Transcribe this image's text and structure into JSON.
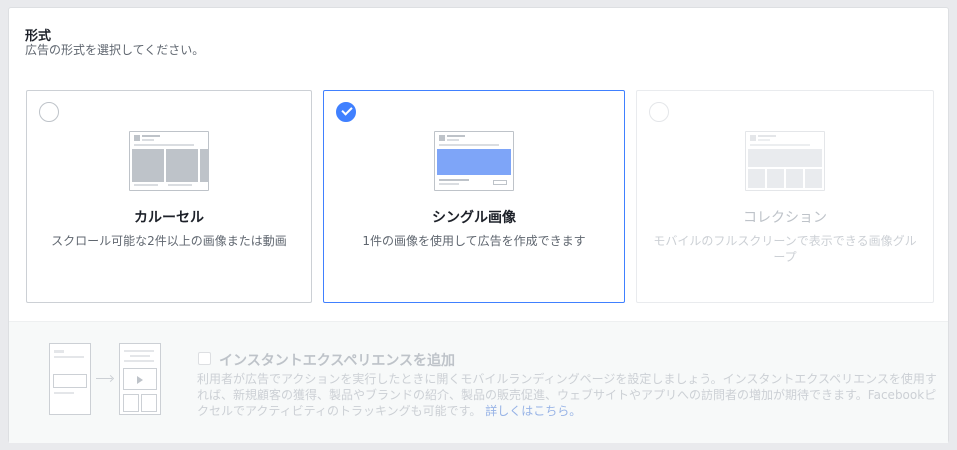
{
  "section": {
    "title": "形式",
    "subtitle": "広告の形式を選択してください。"
  },
  "cards": [
    {
      "title": "カルーセル",
      "desc": "スクロール可能な2件以上の画像または動画",
      "state": "unselected"
    },
    {
      "title": "シングル画像",
      "desc": "1件の画像を使用して広告を作成できます",
      "state": "selected"
    },
    {
      "title": "コレクション",
      "desc": "モバイルのフルスクリーンで表示できる画像グループ",
      "state": "disabled"
    }
  ],
  "instant_experience": {
    "checkbox_label": "インスタントエクスペリエンスを追加",
    "desc": "利用者が広告でアクションを実行したときに開くモバイルランディングページを設定しましょう。インスタントエクスペリエンスを使用すれば、新規顧客の獲得、製品やブランドの紹介、製品の販売促進、ウェブサイトやアプリへの訪問者の増加が期待できます。Facebookピクセルでアクティビティのトラッキングも可能です。",
    "link": "詳しくはこちら。"
  },
  "colors": {
    "accent": "#4080ff",
    "selected_image": "#7ea5f8",
    "text_primary": "#1d2129",
    "text_secondary": "#606770"
  }
}
